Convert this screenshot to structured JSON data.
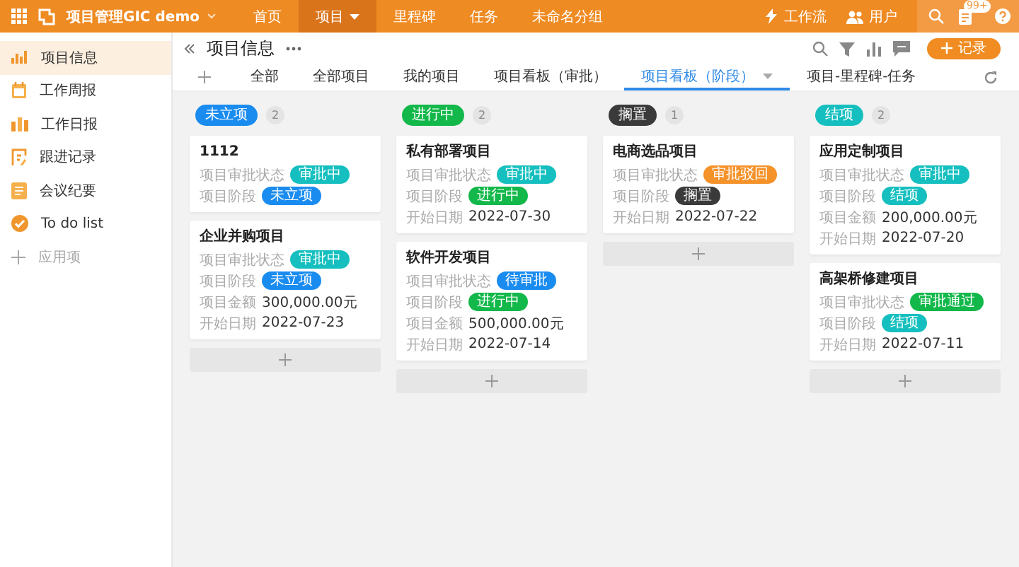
{
  "top_bar": {
    "app_name": "项目管理GIC demo",
    "nav": [
      {
        "label": "首页",
        "selected": false,
        "has_menu": false
      },
      {
        "label": "项目",
        "selected": true,
        "has_menu": true
      },
      {
        "label": "里程碑",
        "selected": false,
        "has_menu": false
      },
      {
        "label": "任务",
        "selected": false,
        "has_menu": false
      },
      {
        "label": "未命名分组",
        "selected": false,
        "has_menu": false
      }
    ],
    "workflow": "工作流",
    "users": "用户",
    "badge": "99+"
  },
  "sidebar": {
    "items": [
      {
        "label": "项目信息",
        "selected": true
      },
      {
        "label": "工作周报",
        "selected": false
      },
      {
        "label": "工作日报",
        "selected": false
      },
      {
        "label": "跟进记录",
        "selected": false
      },
      {
        "label": "会议纪要",
        "selected": false
      },
      {
        "label": "To do list",
        "selected": false
      }
    ],
    "add_label": "应用项"
  },
  "header": {
    "title": "项目信息",
    "add_button": "记录"
  },
  "tabs": [
    {
      "label": "全部",
      "selected": false,
      "has_menu": false
    },
    {
      "label": "全部项目",
      "selected": false,
      "has_menu": false
    },
    {
      "label": "我的项目",
      "selected": false,
      "has_menu": false
    },
    {
      "label": "项目看板（审批）",
      "selected": false,
      "has_menu": false
    },
    {
      "label": "项目看板（阶段）",
      "selected": true,
      "has_menu": true
    },
    {
      "label": "项目-里程碑-任务",
      "selected": false,
      "has_menu": false
    }
  ],
  "board": {
    "columns": [
      {
        "status": "未立项",
        "color": "#1a8cf0",
        "count": "2",
        "cards": [
          {
            "title": "1112",
            "fields": [
              {
                "label": "项目审批状态",
                "kind": "tag",
                "value": "审批中",
                "color": "#16bfbf"
              },
              {
                "label": "项目阶段",
                "kind": "tag",
                "value": "未立项",
                "color": "#1a8cf0"
              }
            ]
          },
          {
            "title": "企业并购项目",
            "fields": [
              {
                "label": "项目审批状态",
                "kind": "tag",
                "value": "审批中",
                "color": "#16bfbf"
              },
              {
                "label": "项目阶段",
                "kind": "tag",
                "value": "未立项",
                "color": "#1a8cf0"
              },
              {
                "label": "项目金额",
                "kind": "text",
                "value": "300,000.00元"
              },
              {
                "label": "开始日期",
                "kind": "text",
                "value": "2022-07-23"
              }
            ]
          }
        ]
      },
      {
        "status": "进行中",
        "color": "#12b84a",
        "count": "2",
        "cards": [
          {
            "title": "私有部署项目",
            "fields": [
              {
                "label": "项目审批状态",
                "kind": "tag",
                "value": "审批中",
                "color": "#16bfbf"
              },
              {
                "label": "项目阶段",
                "kind": "tag",
                "value": "进行中",
                "color": "#12b84a"
              },
              {
                "label": "开始日期",
                "kind": "text",
                "value": "2022-07-30"
              }
            ]
          },
          {
            "title": "软件开发项目",
            "fields": [
              {
                "label": "项目审批状态",
                "kind": "tag",
                "value": "待审批",
                "color": "#1a8cf0"
              },
              {
                "label": "项目阶段",
                "kind": "tag",
                "value": "进行中",
                "color": "#12b84a"
              },
              {
                "label": "项目金额",
                "kind": "text",
                "value": "500,000.00元"
              },
              {
                "label": "开始日期",
                "kind": "text",
                "value": "2022-07-14"
              }
            ]
          }
        ]
      },
      {
        "status": "搁置",
        "color": "#3a3a3a",
        "count": "1",
        "cards": [
          {
            "title": "电商选品项目",
            "fields": [
              {
                "label": "项目审批状态",
                "kind": "tag",
                "value": "审批驳回",
                "color": "#f5922a"
              },
              {
                "label": "项目阶段",
                "kind": "tag",
                "value": "搁置",
                "color": "#3a3a3a"
              },
              {
                "label": "开始日期",
                "kind": "text",
                "value": "2022-07-22"
              }
            ]
          }
        ]
      },
      {
        "status": "结项",
        "color": "#16bfbf",
        "count": "2",
        "cards": [
          {
            "title": "应用定制项目",
            "fields": [
              {
                "label": "项目审批状态",
                "kind": "tag",
                "value": "审批中",
                "color": "#16bfbf"
              },
              {
                "label": "项目阶段",
                "kind": "tag",
                "value": "结项",
                "color": "#16bfbf"
              },
              {
                "label": "项目金额",
                "kind": "text",
                "value": "200,000.00元"
              },
              {
                "label": "开始日期",
                "kind": "text",
                "value": "2022-07-20"
              }
            ]
          },
          {
            "title": "高架桥修建项目",
            "fields": [
              {
                "label": "项目审批状态",
                "kind": "tag",
                "value": "审批通过",
                "color": "#12b84a"
              },
              {
                "label": "项目阶段",
                "kind": "tag",
                "value": "结项",
                "color": "#16bfbf"
              },
              {
                "label": "开始日期",
                "kind": "text",
                "value": "2022-07-11"
              }
            ]
          }
        ]
      }
    ]
  }
}
